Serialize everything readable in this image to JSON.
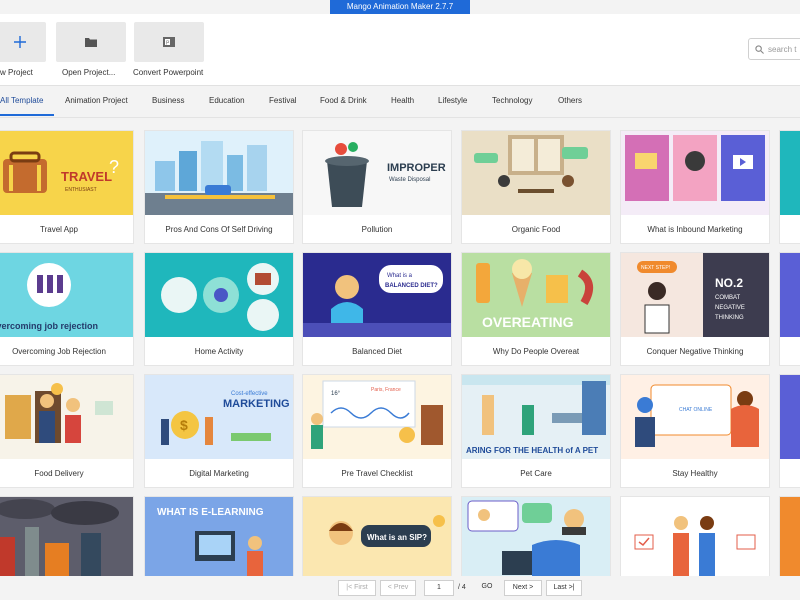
{
  "app": {
    "title": "Mango Animation Maker 2.7.7"
  },
  "toolbar": {
    "new_project": "w Project",
    "open_project": "Open Project...",
    "convert": "Convert Powerpoint",
    "search_placeholder": "search t"
  },
  "tabs": [
    "All Template",
    "Animation Project",
    "Business",
    "Education",
    "Festival",
    "Food & Drink",
    "Health",
    "Lifestyle",
    "Technology",
    "Others"
  ],
  "templates": [
    {
      "title": "Travel App",
      "thumb_text": "TRAVEL",
      "bg": "#f7d44a"
    },
    {
      "title": "Pros And Cons Of Self Driving",
      "thumb_text": "",
      "bg": "#dff1fb"
    },
    {
      "title": "Pollution",
      "thumb_text": "IMPROPER",
      "bg": "#f7f7f7"
    },
    {
      "title": "Organic Food",
      "thumb_text": "",
      "bg": "#eadfc6"
    },
    {
      "title": "What is Inbound Marketing",
      "thumb_text": "",
      "bg": "#f4ecf7"
    },
    {
      "title": "Overcoming Job Rejection",
      "thumb_text": "overcoming job rejection",
      "bg": "#6ed6e2"
    },
    {
      "title": "Home Activity",
      "thumb_text": "",
      "bg": "#1fb7bc"
    },
    {
      "title": "Balanced Diet",
      "thumb_text": "What is a BALANCED DIET?",
      "bg": "#2a2b8f"
    },
    {
      "title": "Why Do People Overeat",
      "thumb_text": "OVEREATING",
      "bg": "#b9dfa2"
    },
    {
      "title": "Conquer Negative Thinking",
      "thumb_text": "NO.2 COMBAT NEGATIVE THINKING",
      "bg": "#f5e7df"
    },
    {
      "title": "Food Delivery",
      "thumb_text": "",
      "bg": "#f7f3e9"
    },
    {
      "title": "Digital Marketing",
      "thumb_text": "MARKETING",
      "bg": "#d8e8fa"
    },
    {
      "title": "Pre Travel Checklist",
      "thumb_text": "",
      "bg": "#fdf4e1"
    },
    {
      "title": "Pet Care",
      "thumb_text": "ARING FOR THE HEALTH of A PET",
      "bg": "#e5f0f5"
    },
    {
      "title": "Stay Healthy",
      "thumb_text": "",
      "bg": "#fff0e5"
    },
    {
      "title": "",
      "thumb_text": "",
      "bg": "#5d5d6b"
    },
    {
      "title": "",
      "thumb_text": "WHAT IS E-LEARNING",
      "bg": "#7ba5e7"
    },
    {
      "title": "",
      "thumb_text": "What is an SIP?",
      "bg": "#fbe7b0"
    },
    {
      "title": "",
      "thumb_text": "",
      "bg": "#d9eef5"
    },
    {
      "title": "",
      "thumb_text": "",
      "bg": "#ffffff"
    }
  ],
  "pager": {
    "first": "|< First",
    "prev": "< Prev",
    "page": "1",
    "total": "/ 4",
    "go": "GO",
    "next": "Next >",
    "last": "Last >|"
  },
  "colors": {
    "accent": "#1f6ad8",
    "title_bar": "#1f6ad8"
  }
}
